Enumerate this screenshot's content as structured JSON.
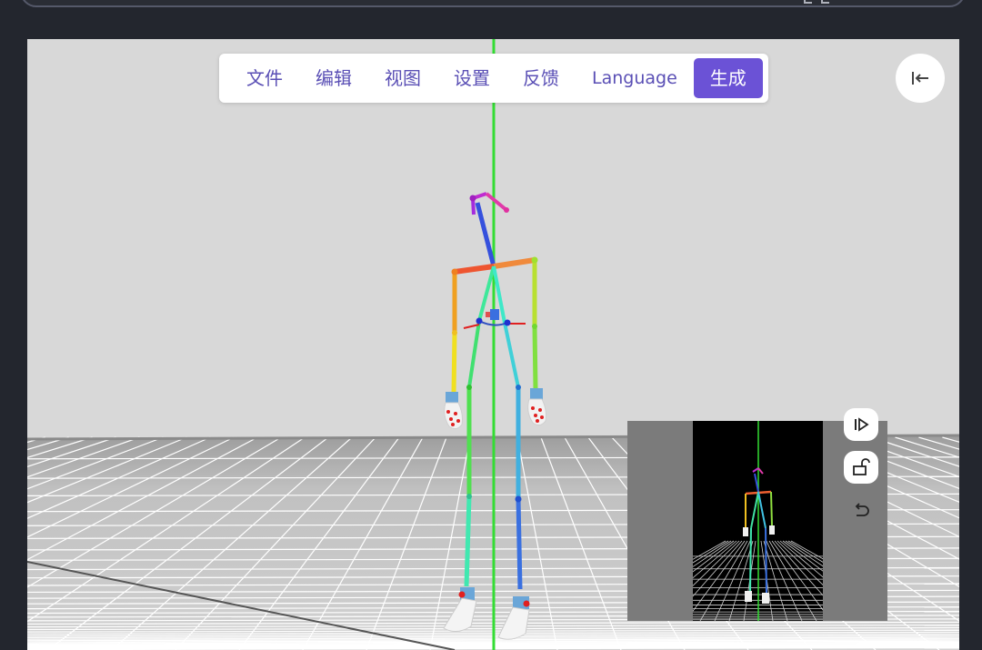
{
  "menu": {
    "file": "文件",
    "edit": "编辑",
    "view": "视图",
    "settings": "设置",
    "feedback": "反馈",
    "language": "Language",
    "generate": "生成"
  },
  "icons": {
    "collapse": "collapse-left-icon",
    "play": "play-step-icon",
    "unlock": "unlock-icon",
    "undo": "undo-icon"
  },
  "colors": {
    "accent": "#6b52d6",
    "menu_text": "#5a4fb5",
    "background": "#23262e",
    "sky": "#d8d8d8",
    "floor": "#a3a3a3",
    "grid": "#ffffff",
    "y_axis": "#33dd33"
  }
}
